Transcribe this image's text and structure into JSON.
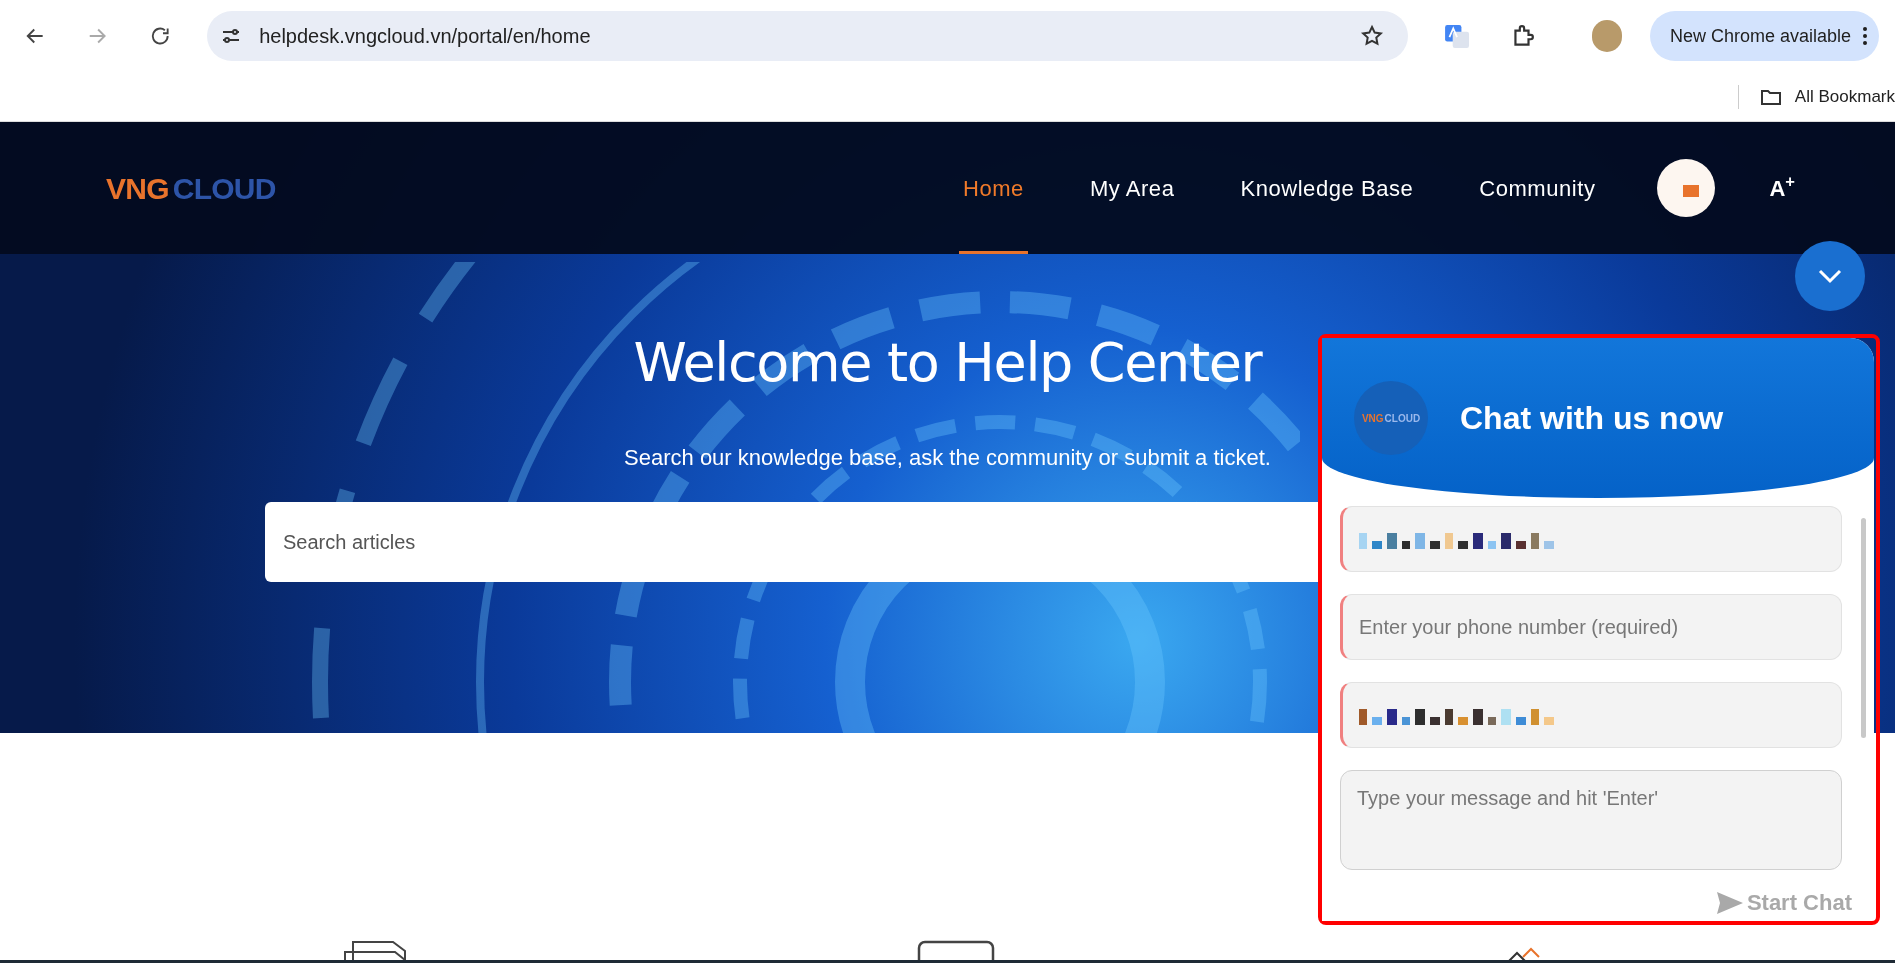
{
  "browser": {
    "url": "helpdesk.vngcloud.vn/portal/en/home",
    "update_button": "New Chrome available",
    "bookmarks": "All Bookmark"
  },
  "site": {
    "logo": [
      "VNG",
      "CLOUD"
    ],
    "nav": [
      {
        "label": "Home",
        "selected": true
      },
      {
        "label": "My Area",
        "selected": false
      },
      {
        "label": "Knowledge Base",
        "selected": false
      },
      {
        "label": "Community",
        "selected": false
      }
    ],
    "font_size_button": "A$^{+}$"
  },
  "hero": {
    "title": "Welcome to Help Center",
    "subtitle": "Search our knowledge base, ask the community or submit a ticket.",
    "search": {
      "placeholder": "Search articles"
    }
  },
  "chat": {
    "title": "Chat with us now",
    "logo": [
      "VNG",
      "CLOUD"
    ],
    "fields": [
      {
        "kind": "input",
        "redacted": true
      },
      {
        "kind": "input",
        "placeholder": "Enter your phone number (required)"
      },
      {
        "kind": "input",
        "redacted": true
      },
      {
        "kind": "textarea",
        "placeholder": "Type your message and hit 'Enter'"
      }
    ],
    "button": {
      "label": "Start Chat",
      "disabled": true
    }
  }
}
